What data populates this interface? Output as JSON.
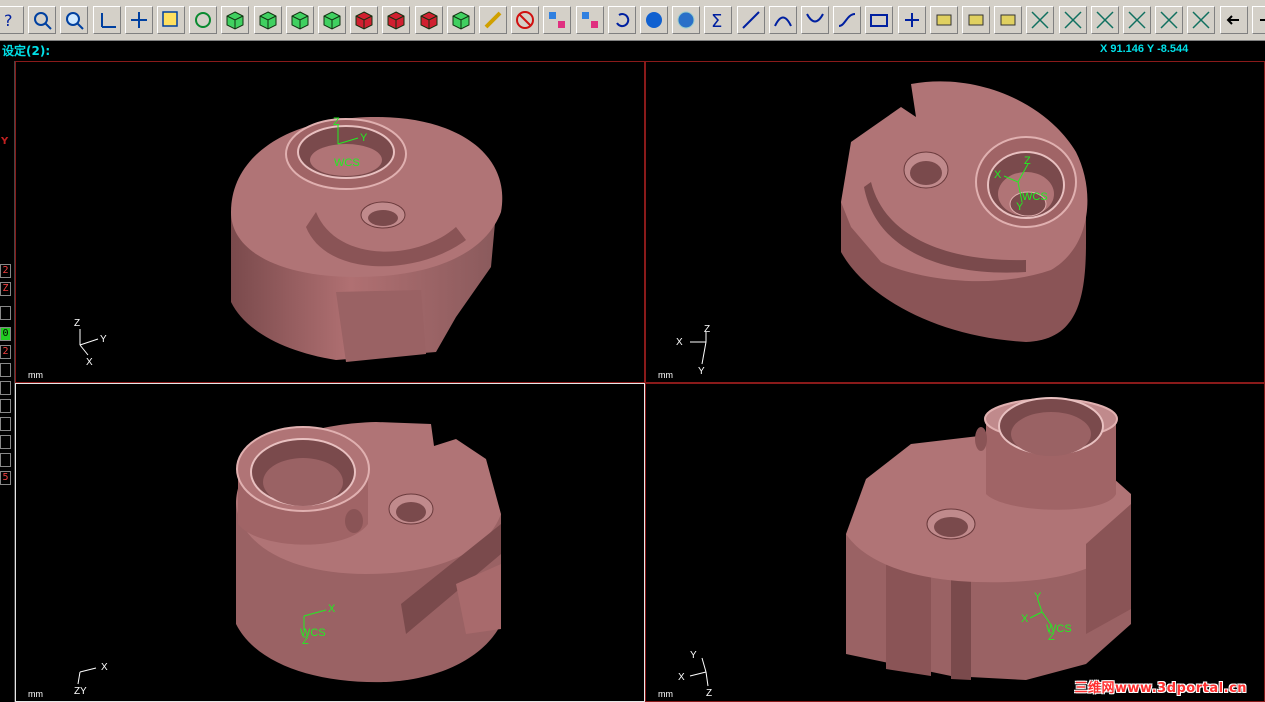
{
  "toolbar": {
    "buttons": [
      {
        "icon": "help-icon"
      },
      {
        "icon": "zoom-window-icon"
      },
      {
        "icon": "zoom-icon"
      },
      {
        "icon": "axis-icon"
      },
      {
        "icon": "pan-icon"
      },
      {
        "icon": "select-icon"
      },
      {
        "icon": "rotate-icon"
      },
      {
        "icon": "view-cube-top-icon"
      },
      {
        "icon": "view-cube-front-icon"
      },
      {
        "icon": "view-cube-side-icon"
      },
      {
        "icon": "view-cube-iso-icon"
      },
      {
        "icon": "view-cube-red-icon"
      },
      {
        "icon": "view-cube-red-right-icon"
      },
      {
        "icon": "view-cube-red-back-icon"
      },
      {
        "icon": "view-cube-3d-icon"
      },
      {
        "icon": "pencil-icon"
      },
      {
        "icon": "no-select-icon"
      },
      {
        "icon": "align-icon"
      },
      {
        "icon": "align-color-icon"
      },
      {
        "icon": "undo-icon"
      },
      {
        "icon": "sphere-icon"
      },
      {
        "icon": "sphere-shaded-icon"
      },
      {
        "icon": "sum-icon"
      },
      {
        "icon": "line-icon"
      },
      {
        "icon": "arc-icon"
      },
      {
        "icon": "fillet-icon"
      },
      {
        "icon": "spline-icon"
      },
      {
        "icon": "rectangle-icon"
      },
      {
        "icon": "point-icon"
      },
      {
        "icon": "face-icon"
      },
      {
        "icon": "solid-icon"
      },
      {
        "icon": "tree-icon"
      },
      {
        "icon": "trim-icon"
      },
      {
        "icon": "trim-2-icon"
      },
      {
        "icon": "trim-3-icon"
      },
      {
        "icon": "trim-4-icon"
      },
      {
        "icon": "extend-icon"
      },
      {
        "icon": "break-icon"
      },
      {
        "icon": "arrow-left-icon"
      },
      {
        "icon": "arrow-right-icon"
      }
    ]
  },
  "status": {
    "mode_label": "设定(2):",
    "coords": "X 91.146  Y -8.544"
  },
  "left_strip": {
    "axis_label": "Y",
    "cells": [
      {
        "text": "2",
        "green": false
      },
      {
        "text": "Z",
        "green": false
      },
      {
        "text": "",
        "green": false
      },
      {
        "text": "0",
        "green": true
      },
      {
        "text": "2",
        "green": false
      },
      {
        "text": "",
        "green": false
      },
      {
        "text": "",
        "green": false
      },
      {
        "text": "",
        "green": false
      },
      {
        "text": "",
        "green": false
      },
      {
        "text": "",
        "green": false
      },
      {
        "text": "",
        "green": false
      },
      {
        "text": "5",
        "green": false
      }
    ]
  },
  "viewports": {
    "top_left": {
      "unit": "mm",
      "triad": {
        "a": "Z",
        "b": "Y",
        "c": "X"
      },
      "wcs": {
        "a": "Z",
        "b": "Y",
        "label": "WCS"
      }
    },
    "top_right": {
      "unit": "mm",
      "triad": {
        "a": "Z",
        "b": "X",
        "c": "Y"
      },
      "wcs": {
        "a": "Z",
        "b": "X",
        "c": "Y",
        "label": "WCS"
      }
    },
    "bottom_left": {
      "unit": "mm",
      "triad": {
        "a": "X",
        "b": "Z",
        "c": "Y"
      },
      "wcs": {
        "a": "X",
        "label": "WCS",
        "z": "Z"
      }
    },
    "bottom_right": {
      "unit": "mm",
      "triad": {
        "a": "Y",
        "b": "X",
        "c": "Z"
      },
      "wcs": {
        "a": "Y",
        "b": "X",
        "label": "WCS",
        "z": "Z"
      }
    }
  },
  "colors": {
    "part_face": "#a86a6c",
    "part_top": "#b87a7c",
    "part_dark": "#7a4a4c",
    "part_highlight": "#e8b8b8",
    "accent": "#00e0e8"
  },
  "watermark": "三维网www.3dportal.cn"
}
